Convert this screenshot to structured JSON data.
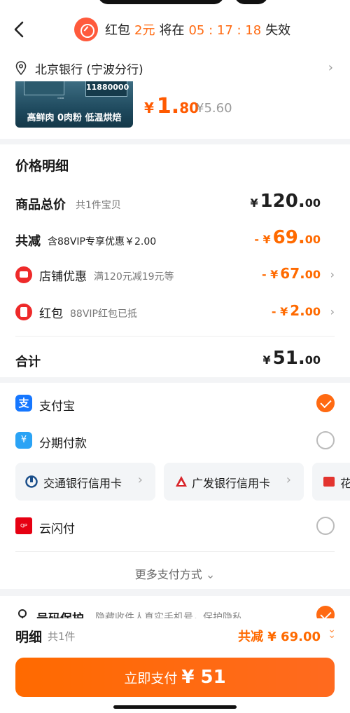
{
  "header": {
    "redpacket_label": "红包",
    "redpacket_amount": "2元",
    "expire_prefix": "将在",
    "countdown": "05 : 17 : 18",
    "expire_suffix": "失效"
  },
  "address": {
    "text": "北京银行 (宁波分行)"
  },
  "product": {
    "image_caption": "高鲜肉 0肉粉 低温烘焙",
    "image_number": "11880000",
    "price_symbol": "¥",
    "price_int": "1.",
    "price_dec": "80",
    "original_price": "¥5.60"
  },
  "price_detail": {
    "title": "价格明细",
    "total": {
      "label": "商品总价",
      "sub": "共1件宝贝",
      "symbol": "¥",
      "int": "120.",
      "dec": "00"
    },
    "discount": {
      "label": "共减",
      "sub": "含88VIP专享优惠￥2.00",
      "symbol": "- ¥",
      "int": "69.",
      "dec": "00"
    },
    "store": {
      "label": "店铺优惠",
      "sub": "满120元减19元等",
      "symbol": "- ¥",
      "int": "67.",
      "dec": "00"
    },
    "redpack": {
      "label": "红包",
      "sub": "88VIP红包已抵",
      "symbol": "- ¥",
      "int": "2.",
      "dec": "00"
    },
    "sum": {
      "label": "合计",
      "symbol": "¥",
      "int": "51.",
      "dec": "00"
    }
  },
  "payment": {
    "alipay": "支付宝",
    "installment": "分期付款",
    "banks": [
      "交通银行信用卡",
      "广发银行信用卡",
      "花"
    ],
    "unionpay": "云闪付",
    "more": "更多支付方式"
  },
  "privacy": {
    "label": "号码保护",
    "sub": "隐藏收件人真实手机号，保护隐私"
  },
  "bottom": {
    "detail": "明细",
    "count": "共1件",
    "saved": "共减 ¥ 69.00",
    "pay_label": "立即支付",
    "pay_amount": "¥ 51"
  },
  "colors": {
    "accent": "#ff6a12",
    "alipay": "#1677ff",
    "red": "#ee2a2a"
  }
}
